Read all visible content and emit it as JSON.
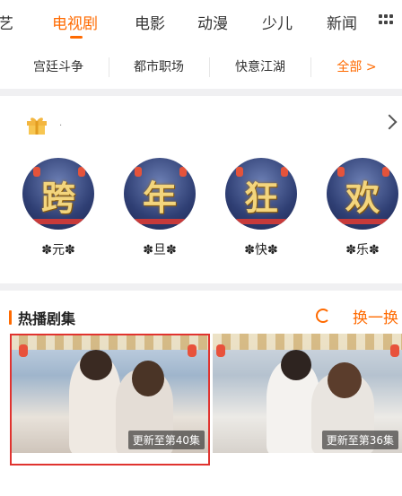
{
  "nav": {
    "tabs": [
      {
        "label": "艺"
      },
      {
        "label": "电视剧",
        "active": true
      },
      {
        "label": "电影"
      },
      {
        "label": "动漫"
      },
      {
        "label": "少儿"
      },
      {
        "label": "新闻"
      }
    ],
    "more_icon": "grid-menu-icon",
    "accent": "#ff6a00"
  },
  "subcategories": [
    "宫廷斗争",
    "都市职场",
    "快意江湖",
    "全部 >"
  ],
  "gift_row": {
    "icon": "gift-icon",
    "text": "."
  },
  "circles": [
    {
      "glyph": "跨",
      "label": "✽元✽"
    },
    {
      "glyph": "年",
      "label": "✽旦✽"
    },
    {
      "glyph": "狂",
      "label": "✽快✽"
    },
    {
      "glyph": "欢",
      "label": "✽乐✽"
    }
  ],
  "hot": {
    "title": "热播剧集",
    "refresh_label": "换一换",
    "posters": [
      {
        "badge": "更新至第40集",
        "selected": true
      },
      {
        "badge": "更新至第36集"
      }
    ]
  }
}
